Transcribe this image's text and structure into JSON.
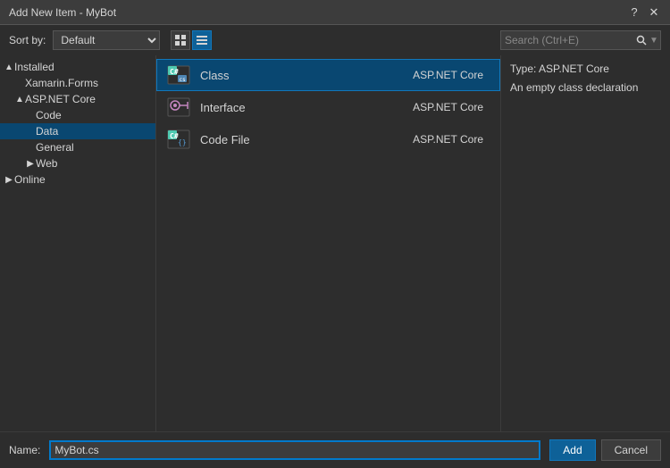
{
  "titleBar": {
    "title": "Add New Item - MyBot"
  },
  "topBar": {
    "sortLabel": "Sort by:",
    "sortDefault": "Default",
    "searchPlaceholder": "Search (Ctrl+E)"
  },
  "sidebar": {
    "sections": [
      {
        "id": "installed",
        "label": "Installed",
        "indent": "indent1",
        "expanded": true,
        "toggle": "▲"
      },
      {
        "id": "xamarin",
        "label": "Xamarin.Forms",
        "indent": "indent2",
        "expanded": false,
        "toggle": ""
      },
      {
        "id": "aspnet",
        "label": "ASP.NET Core",
        "indent": "indent2",
        "expanded": true,
        "toggle": "▲"
      },
      {
        "id": "code",
        "label": "Code",
        "indent": "indent3",
        "expanded": false,
        "toggle": ""
      },
      {
        "id": "data",
        "label": "Data",
        "indent": "indent3",
        "expanded": false,
        "toggle": ""
      },
      {
        "id": "general",
        "label": "General",
        "indent": "indent3",
        "expanded": false,
        "toggle": ""
      },
      {
        "id": "web",
        "label": "Web",
        "indent": "indent3",
        "expanded": false,
        "toggle": "▶"
      },
      {
        "id": "online",
        "label": "Online",
        "indent": "indent1",
        "expanded": false,
        "toggle": "▶"
      }
    ]
  },
  "items": [
    {
      "id": "class",
      "name": "Class",
      "type": "ASP.NET Core",
      "selected": true
    },
    {
      "id": "interface",
      "name": "Interface",
      "type": "ASP.NET Core",
      "selected": false
    },
    {
      "id": "codefile",
      "name": "Code File",
      "type": "ASP.NET Core",
      "selected": false
    }
  ],
  "infoPanel": {
    "typeLabel": "Type: ASP.NET Core",
    "description": "An empty class declaration"
  },
  "bottomBar": {
    "nameLabel": "Name:",
    "nameValue": "MyBot.cs",
    "addButton": "Add",
    "cancelButton": "Cancel"
  }
}
